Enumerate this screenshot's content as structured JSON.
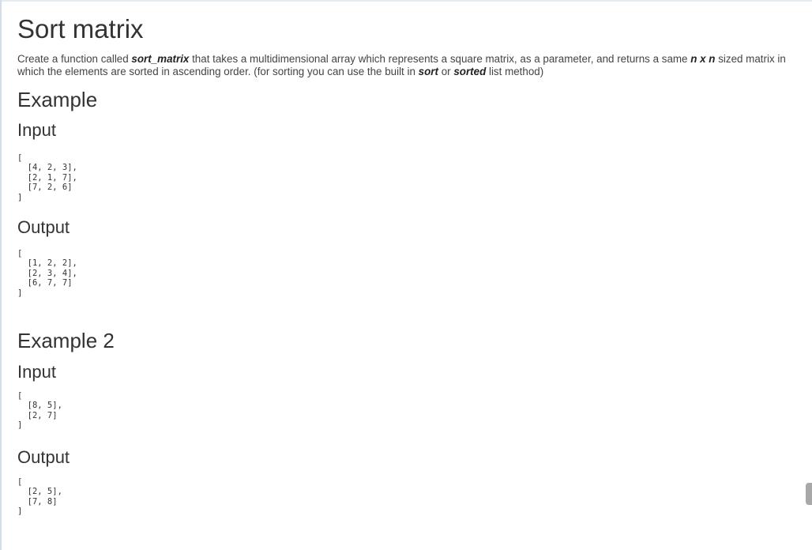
{
  "title": "Sort matrix",
  "description": {
    "part1": "Create a function called ",
    "fn_name": "sort_matrix",
    "part2": " that takes a multidimensional array which represents a square matrix, as a parameter, and returns a same ",
    "nxn": "n x n",
    "part3": " sized matrix in which the elements are sorted in ascending order. (for sorting you can use the built in ",
    "sort": "sort",
    "part4": " or ",
    "sorted": "sorted",
    "part5": " list method)"
  },
  "examples": [
    {
      "heading": "Example",
      "input_label": "Input",
      "input_lines": [
        "[",
        "  [4, 2, 3],",
        "  [2, 1, 7],",
        "  [7, 2, 6]",
        "]"
      ],
      "output_label": "Output",
      "output_lines": [
        "[",
        "  [1, 2, 2],",
        "  [2, 3, 4],",
        "  [6, 7, 7]",
        "]"
      ]
    },
    {
      "heading": "Example 2",
      "input_label": "Input",
      "input_lines": [
        "[",
        "  [8, 5],",
        "  [2, 7]",
        "]"
      ],
      "output_label": "Output",
      "output_lines": [
        "[",
        "  [2, 5],",
        "  [7, 8]",
        "]"
      ]
    }
  ]
}
